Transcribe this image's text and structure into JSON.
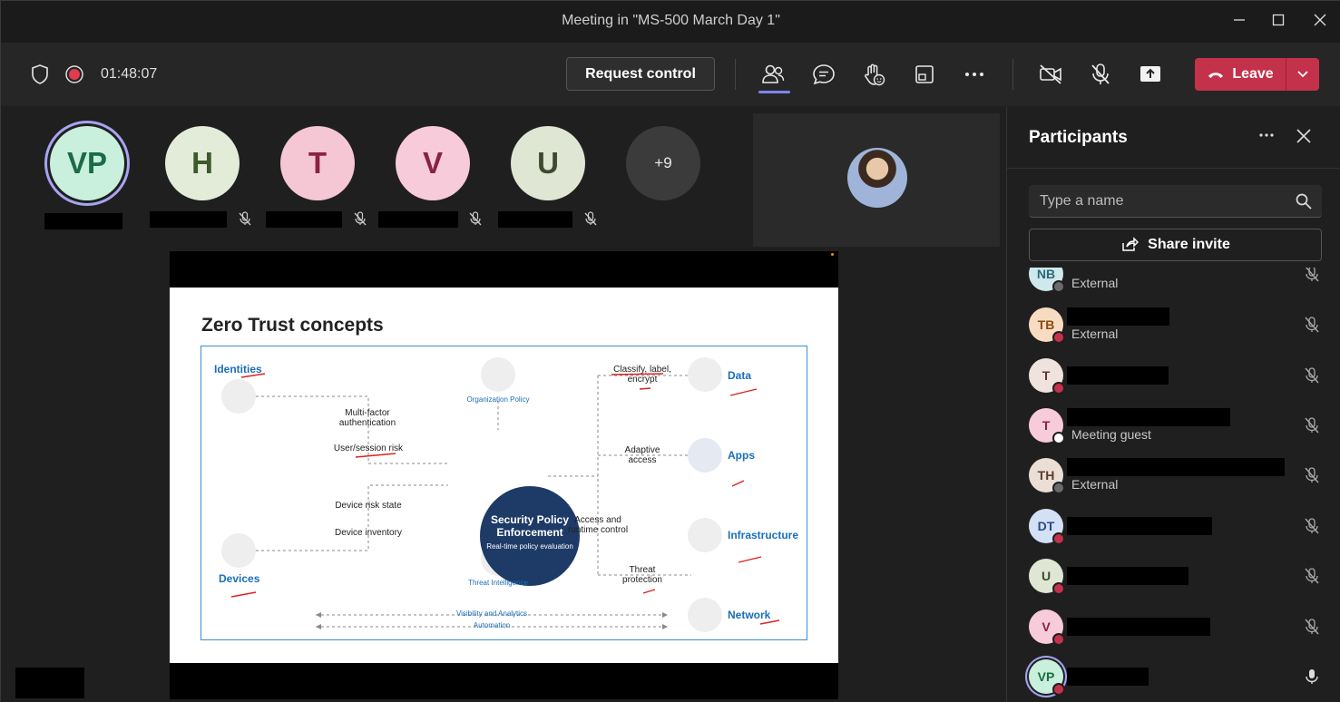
{
  "window": {
    "title": "Meeting in \"MS-500 March Day 1\""
  },
  "toolbar": {
    "timer": "01:48:07",
    "request_control_label": "Request control",
    "leave_label": "Leave"
  },
  "gallery": {
    "avatars": [
      {
        "initials": "VP",
        "bg": "#c8f0dc",
        "fg": "#1d6b45"
      },
      {
        "initials": "H",
        "bg": "#e3ecd9",
        "fg": "#3d5a2a"
      },
      {
        "initials": "T",
        "bg": "#f5c6d4",
        "fg": "#8a2244"
      },
      {
        "initials": "V",
        "bg": "#f7cbd9",
        "fg": "#8a2244"
      },
      {
        "initials": "U",
        "bg": "#dfe6d3",
        "fg": "#3d4a30"
      }
    ],
    "overflow_label": "+9"
  },
  "slide": {
    "title": "Zero Trust concepts",
    "core_title": "Security Policy Enforcement",
    "core_subtitle": "Real-time policy evaluation",
    "org_policy": "Organization Policy",
    "threat_intel": "Threat Intelligence",
    "identities": "Identities",
    "devices": "Devices",
    "data": "Data",
    "apps": "Apps",
    "infrastructure": "Infrastructure",
    "network": "Network",
    "mfa": "Multi-factor authentication",
    "user_session_risk": "User/session risk",
    "device_risk_state": "Device risk state",
    "device_inventory": "Device inventory",
    "classify": "Classify, label, encrypt",
    "adaptive_access": "Adaptive access",
    "access_runtime": "Access and runtime control",
    "threat_protection": "Threat protection",
    "visibility": "Visibility and Analytics",
    "automation": "Automation"
  },
  "panel": {
    "title": "Participants",
    "search_placeholder": "Type a name",
    "share_invite_label": "Share invite",
    "participants": [
      {
        "initials": "NB",
        "subtitle": "External",
        "bg": "#cfe8ec",
        "fg": "#2a6a78",
        "status": "#6a6a6a"
      },
      {
        "initials": "TB",
        "subtitle": "External",
        "bg": "#f8dcc2",
        "fg": "#8a4a12",
        "status": "#c4314b"
      },
      {
        "initials": "T",
        "subtitle": "",
        "bg": "#f0e2dc",
        "fg": "#5e3a2e",
        "status": "#c4314b"
      },
      {
        "initials": "T",
        "subtitle": "Meeting guest",
        "bg": "#f7cbd9",
        "fg": "#8a2244",
        "status": "#ffffff"
      },
      {
        "initials": "TH",
        "subtitle": "External",
        "bg": "#eaded5",
        "fg": "#5e3a2e",
        "status": "#6a6a6a"
      },
      {
        "initials": "DT",
        "subtitle": "",
        "bg": "#d3e0f5",
        "fg": "#2a4a88",
        "status": "#c4314b"
      },
      {
        "initials": "U",
        "subtitle": "",
        "bg": "#dfe6d3",
        "fg": "#3d4a30",
        "status": "#c4314b"
      },
      {
        "initials": "V",
        "subtitle": "",
        "bg": "#f7cbd9",
        "fg": "#8a2244",
        "status": "#c4314b"
      },
      {
        "initials": "VP",
        "subtitle": "",
        "bg": "#c8f0dc",
        "fg": "#1d6b45",
        "status": "#c4314b"
      }
    ]
  }
}
